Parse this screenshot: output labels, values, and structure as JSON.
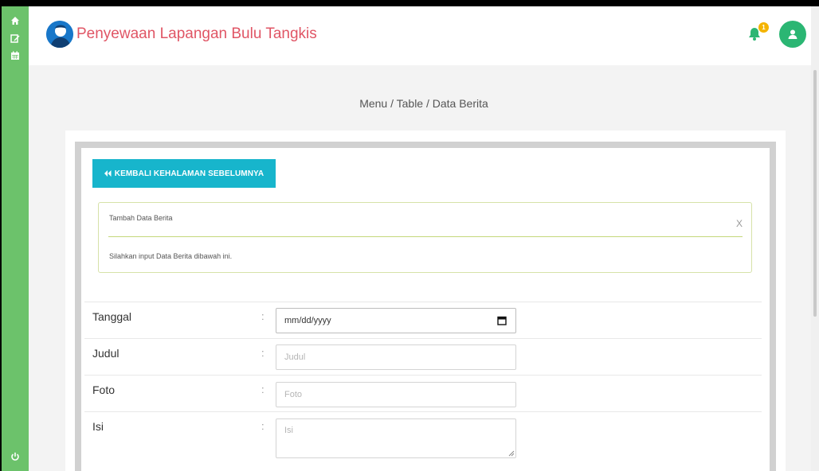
{
  "app": {
    "title": "Penyewaan Lapangan Bulu Tangkis",
    "notification_count": "1"
  },
  "sidebar": {
    "items": [
      {
        "icon": "home-icon"
      },
      {
        "icon": "edit-icon"
      },
      {
        "icon": "calendar-icon"
      },
      {
        "icon": "power-icon"
      }
    ]
  },
  "breadcrumb": "Menu / Table / Data Berita",
  "back_button": {
    "label": "KEMBALI KEHALAMAN SEBELUMNYA",
    "icon": "double-chevron-left-icon"
  },
  "alert": {
    "title": "Tambah Data Berita",
    "close": "X",
    "message": "Silahkan input Data Berita dibawah ini."
  },
  "form": {
    "colon": ":",
    "tanggal": {
      "label": "Tanggal",
      "value": "mm/dd/yyyy"
    },
    "judul": {
      "label": "Judul",
      "placeholder": "Judul"
    },
    "foto": {
      "label": "Foto",
      "placeholder": "Foto"
    },
    "isi": {
      "label": "Isi",
      "placeholder": "Isi"
    }
  },
  "colors": {
    "sidebar": "#6cc26b",
    "brand_title": "#e05565",
    "button": "#17b5cc",
    "avatar": "#2bb673",
    "badge": "#f4b400",
    "alert_border": "#d6e2a8"
  }
}
